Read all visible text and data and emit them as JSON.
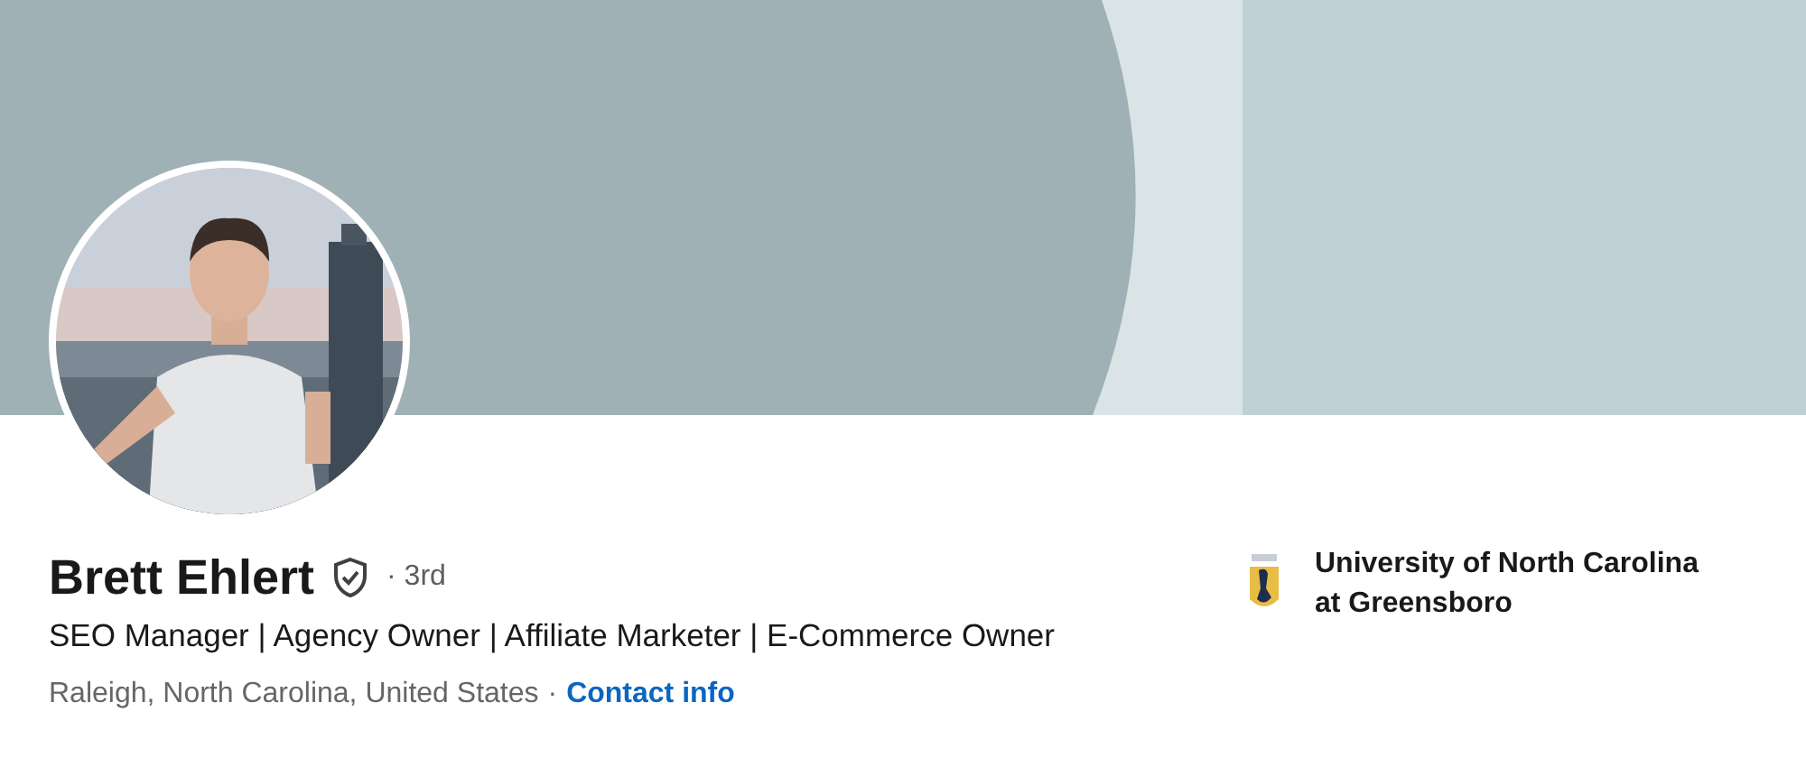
{
  "profile": {
    "name": "Brett Ehlert",
    "degree": "· 3rd",
    "headline": "SEO Manager | Agency Owner | Affiliate Marketer | E-Commerce Owner",
    "location": "Raleigh, North Carolina, United States",
    "separator": "·",
    "contact_link": "Contact info"
  },
  "education": {
    "school": "University of North Carolina at Greensboro"
  }
}
